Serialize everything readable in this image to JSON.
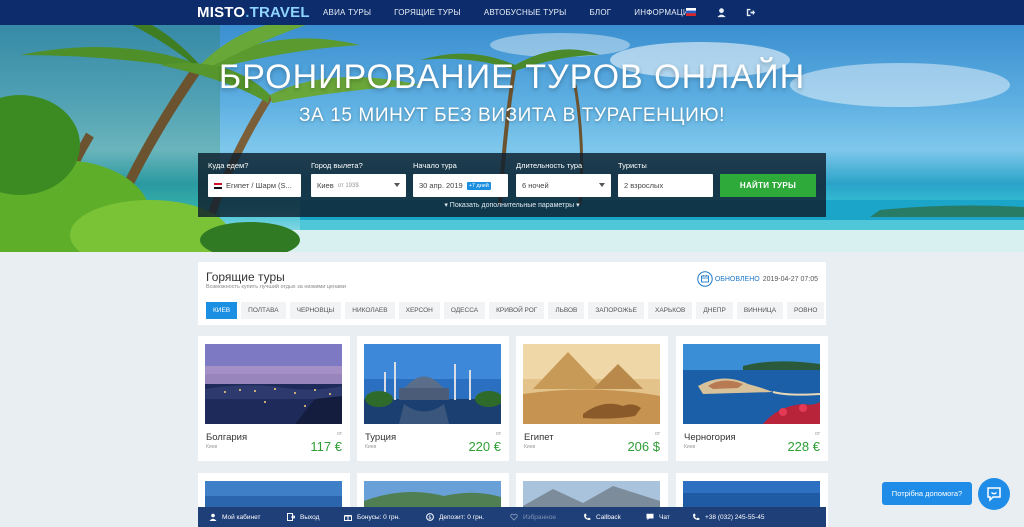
{
  "header": {
    "logo_main": "MISTO",
    "logo_dot": ".",
    "logo_suffix": "TRAVEL",
    "nav": [
      "АВИА ТУРЫ",
      "ГОРЯЩИЕ ТУРЫ",
      "АВТОБУСНЫЕ ТУРЫ",
      "БЛОГ",
      "ИНФОРМАЦИЯ"
    ],
    "icons": [
      "russian-flag-icon",
      "user-icon",
      "logout-icon"
    ]
  },
  "hero": {
    "title": "БРОНИРОВАНИЕ ТУРОВ ОНЛАЙН",
    "subtitle": "ЗА 15 МИНУТ БЕЗ ВИЗИТА В ТУРАГЕНЦИЮ!"
  },
  "search": {
    "destination_label": "Куда едем?",
    "destination_value": "Египет / Шарм (S...",
    "departure_label": "Город вылета?",
    "departure_value": "Киев",
    "departure_hint": "от 193$",
    "start_label": "Начало тура",
    "start_value": "30 апр. 2019",
    "start_tag": "+7 дней",
    "duration_label": "Длительность тура",
    "duration_value": "6 ночей",
    "tourists_label": "Туристы",
    "tourists_value": "2 взрослых",
    "find_button": "НАЙТИ ТУРЫ",
    "more_params": "▾ Показать дополнительные параметры ▾"
  },
  "hot_tours": {
    "title": "Горящие туры",
    "subtitle": "Возможность купить лучший отдых за низкими ценами",
    "updated_label": "ОБНОВЛЕНО",
    "updated_value": "2019-04-27 07:05",
    "cities": [
      "КИЕВ",
      "ПОЛТАВА",
      "ЧЕРНОВЦЫ",
      "НИКОЛАЕВ",
      "ХЕРСОН",
      "ОДЕССА",
      "КРИВОЙ РОГ",
      "ЛЬВОВ",
      "ЗАПОРОЖЬЕ",
      "ХАРЬКОВ",
      "ДНЕПР",
      "ВИННИЦА",
      "РОВНО"
    ],
    "active_city": "КИЕВ"
  },
  "cards": [
    {
      "name": "Болгария",
      "from": "Киев",
      "ot": "от",
      "price": "117 €"
    },
    {
      "name": "Турция",
      "from": "Киев",
      "ot": "от",
      "price": "220 €"
    },
    {
      "name": "Египет",
      "from": "Киев",
      "ot": "от",
      "price": "206 $"
    },
    {
      "name": "Черногория",
      "from": "Киев",
      "ot": "от",
      "price": "228 €"
    }
  ],
  "bottom_bar": {
    "cabinet": "Мой кабинет",
    "logout": "Выход",
    "bonuses": "Бонусы: 0 грн.",
    "deposit": "Депозит: 0 грн.",
    "favorites": "Избранное",
    "callback": "Callback",
    "chat": "Чат",
    "phone": "+38 (032) 245-55-45"
  },
  "help": {
    "bubble": "Потрібна допомога?"
  },
  "colors": {
    "navbar": "#0d2c6b",
    "accent_blue": "#1b8fe2",
    "find_button": "#2eaa3b",
    "price_green": "#2e9e35",
    "bottombar": "#1f3f78"
  }
}
